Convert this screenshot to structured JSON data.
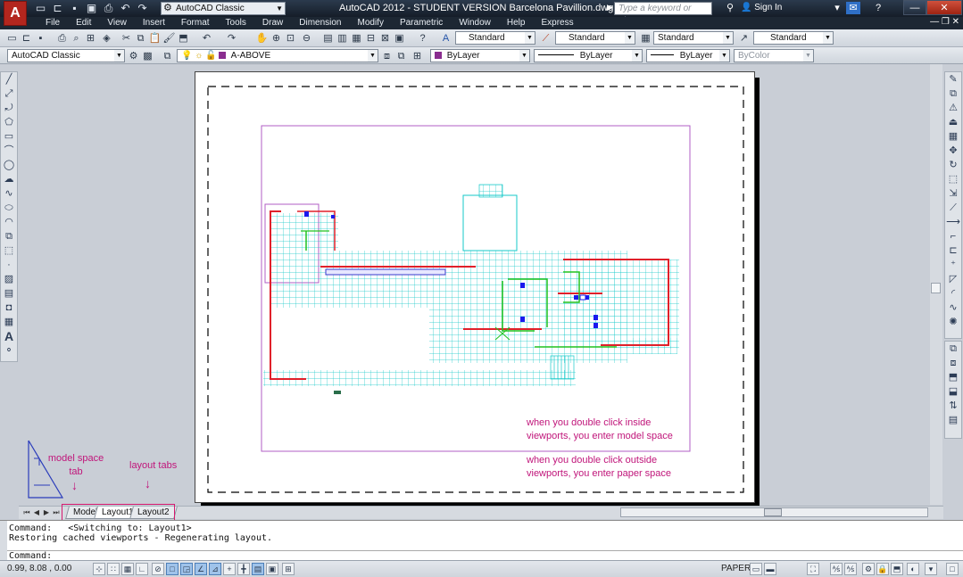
{
  "titlebar": {
    "app_logo": "A",
    "workspace": "AutoCAD Classic",
    "title": "AutoCAD 2012 - STUDENT VERSION   Barcelona Pavillion.dwg",
    "search_placeholder": "Type a keyword or phrase",
    "sign_in": "Sign In",
    "minimize": "—",
    "restore": "❐",
    "close": "✕"
  },
  "menubar": {
    "items": [
      "File",
      "Edit",
      "View",
      "Insert",
      "Format",
      "Tools",
      "Draw",
      "Dimension",
      "Modify",
      "Parametric",
      "Window",
      "Help",
      "Express"
    ],
    "mdi_controls": "— ❐ ✕"
  },
  "toolbar": {
    "text_style": "Standard",
    "dim_style": "Standard",
    "table_style": "Standard",
    "mleader_style": "Standard",
    "workspace": "AutoCAD Classic",
    "layer": "A-ABOVE",
    "color": "ByLayer",
    "linetype": "ByLayer",
    "lineweight": "ByLayer",
    "plotstyle": "ByColor"
  },
  "annotations": {
    "model_space_tab": "model space\ntab",
    "layout_tabs": "layout tabs",
    "inside_note": "when you double click inside\nviewports, you enter model space",
    "outside_note": "when you double click outside\nviewports, you enter paper space"
  },
  "tabs": [
    "Model",
    "Layout1",
    "Layout2"
  ],
  "command_line": {
    "history": "Command:   <Switching to: Layout1>\nRestoring cached viewports - Regenerating layout.",
    "prompt": "Command:"
  },
  "statusbar": {
    "coordinates": "0.99, 8.08 , 0.00",
    "space": "PAPER"
  },
  "colors": {
    "annotation": "#c0157a",
    "grid": "#16c9c9",
    "walls": "#e0202a",
    "green_walls": "#21c21f",
    "viewport": "#b05cc4"
  }
}
